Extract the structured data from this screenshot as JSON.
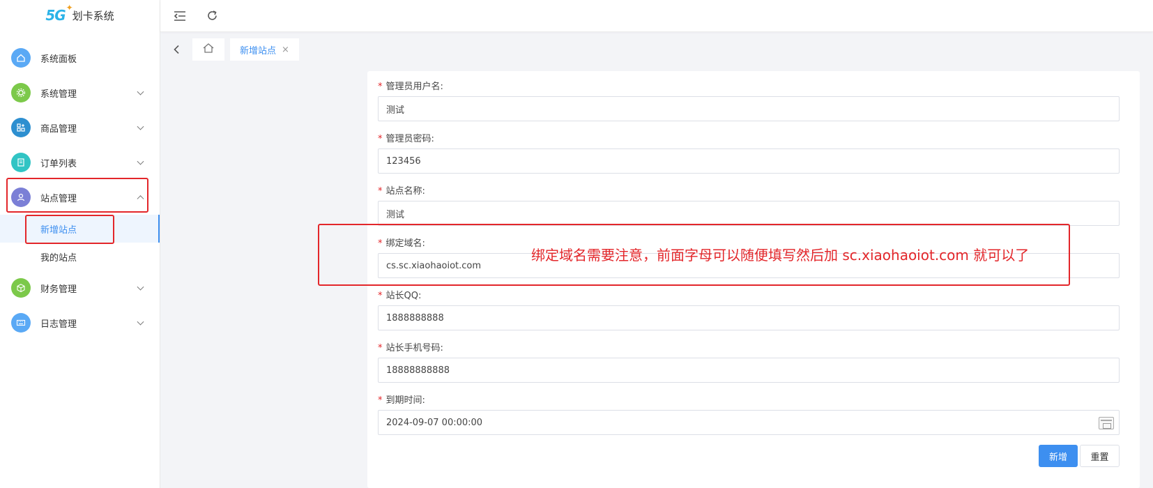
{
  "app": {
    "brand_logo": "5G",
    "title": "划卡系统"
  },
  "sidebar": {
    "items": [
      {
        "label": "系统面板",
        "icon": "home-icon",
        "color": "#5aa9f5"
      },
      {
        "label": "系统管理",
        "icon": "gear-icon",
        "color": "#7cc94a"
      },
      {
        "label": "商品管理",
        "icon": "grid-plus-icon",
        "color": "#2d8fd0"
      },
      {
        "label": "订单列表",
        "icon": "clipboard-icon",
        "color": "#31c4c4"
      },
      {
        "label": "站点管理",
        "icon": "user-site-icon",
        "color": "#7b7fd6"
      },
      {
        "label": "财务管理",
        "icon": "cube-icon",
        "color": "#7cc94a"
      },
      {
        "label": "日志管理",
        "icon": "keyboard-icon",
        "color": "#5aa9f5"
      }
    ],
    "site_sub_items": [
      {
        "label": "新增站点",
        "active": true
      },
      {
        "label": "我的站点",
        "active": false
      }
    ]
  },
  "tabs": {
    "home_icon": "home-icon",
    "active_label": "新增站点",
    "close_glyph": "×"
  },
  "form": {
    "fields": [
      {
        "label": "管理员用户名:",
        "value": "测试"
      },
      {
        "label": "管理员密码:",
        "value": "123456"
      },
      {
        "label": "站点名称:",
        "value": "测试"
      },
      {
        "label": "绑定域名:",
        "value": "cs.sc.xiaohaoiot.com"
      },
      {
        "label": "站长QQ:",
        "value": "1888888888"
      },
      {
        "label": "站长手机号码:",
        "value": "18888888888"
      },
      {
        "label": "到期时间:",
        "value": "2024-09-07 00:00:00"
      }
    ],
    "required_mark": "*",
    "submit_label": "新增",
    "reset_label": "重置"
  },
  "annotation": {
    "text": "绑定域名需要注意，前面字母可以随便填写然后加 sc.xiaohaoiot.com 就可以了",
    "color": "#e3262a"
  },
  "colors": {
    "accent": "#3d8ff0",
    "annotation": "#e3262a"
  }
}
